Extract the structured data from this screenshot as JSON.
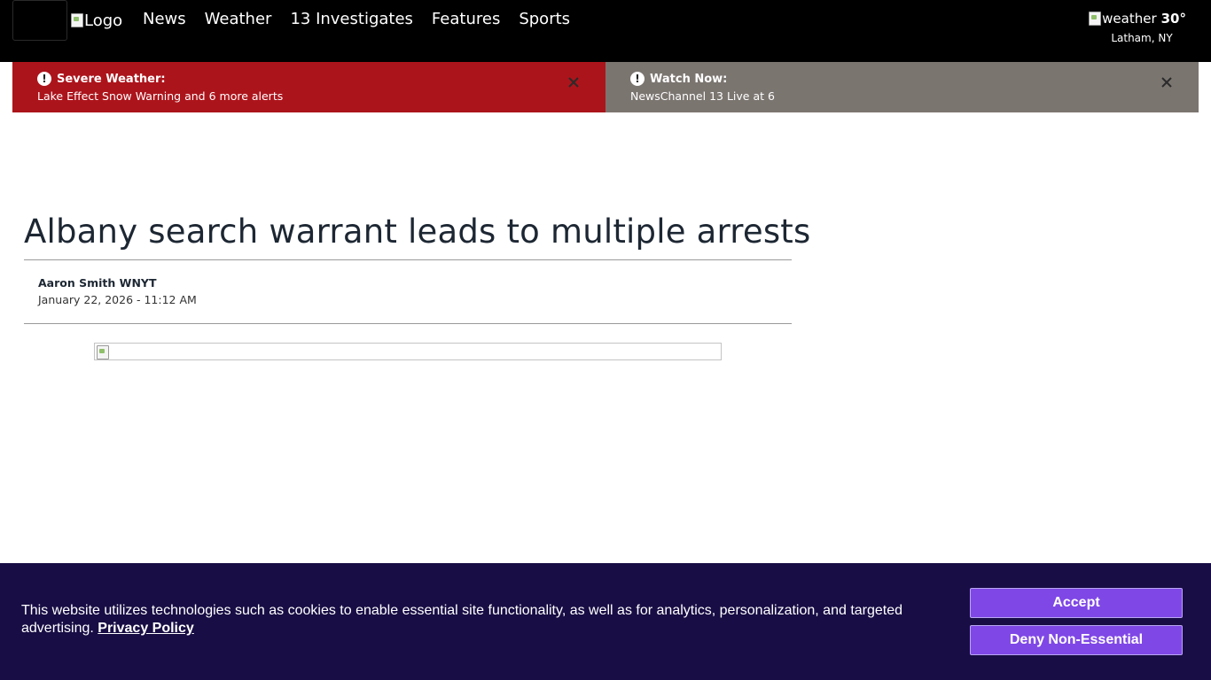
{
  "header": {
    "logo_alt": "Logo",
    "nav": [
      "News",
      "Weather",
      "13 Investigates",
      "Features",
      "Sports"
    ],
    "weather": {
      "img_alt": "weather",
      "temperature": "30°",
      "location": "Latham, NY"
    }
  },
  "alerts": [
    {
      "title": "Severe Weather:",
      "body": "Lake Effect Snow Warning and 6 more alerts",
      "color": "#ac141b"
    },
    {
      "title": "Watch Now:",
      "body": "NewsChannel 13 Live at 6",
      "color": "#7b7570"
    }
  ],
  "article": {
    "headline": "Albany search warrant leads to multiple arrests",
    "author": "Aaron Smith WNYT",
    "date": "January 22, 2026 - 11:12 AM"
  },
  "cookie": {
    "text": "This website utilizes technologies such as cookies to enable essential site functionality, as well as for analytics, personalization, and targeted advertising.",
    "privacy_link": "Privacy Policy",
    "accept_label": "Accept",
    "deny_label": "Deny Non-Essential",
    "background": "#180d44",
    "button_color": "#7f47e6"
  },
  "icons": {
    "alert": "exclamation-circle-icon",
    "close": "close-icon",
    "broken_image": "broken-image-icon"
  }
}
